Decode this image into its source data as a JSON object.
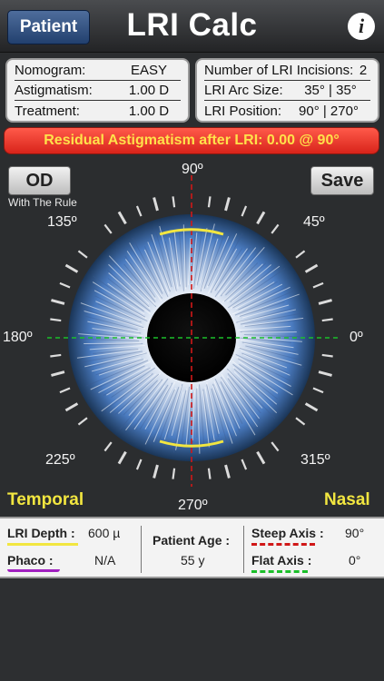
{
  "nav": {
    "back_label": "Patient",
    "title": "LRI Calc",
    "info_icon": "i"
  },
  "summary_left": {
    "nomogram_label": "Nomogram:",
    "nomogram_value": "EASY",
    "astigmatism_label": "Astigmatism:",
    "astigmatism_value": "1.00 D",
    "treatment_label": "Treatment:",
    "treatment_value": "1.00 D"
  },
  "summary_right": {
    "incisions_label": "Number of LRI Incisions:",
    "incisions_value": "2",
    "arc_label": "LRI Arc Size:",
    "arc_value": "35° | 35°",
    "position_label": "LRI Position:",
    "position_value": "90° | 270°"
  },
  "warning": "Residual Astigmatism after LRI: 0.00 @ 90°",
  "eye": {
    "eye_button": "OD",
    "rule_label": "With The Rule",
    "save_button": "Save",
    "deg_90": "90º",
    "deg_45": "45º",
    "deg_135": "135º",
    "deg_180": "180º",
    "deg_0": "0º",
    "deg_225": "225º",
    "deg_315": "315º",
    "deg_270": "270º",
    "temporal": "Temporal",
    "nasal": "Nasal"
  },
  "bottom": {
    "lri_depth_label": "LRI Depth :",
    "lri_depth_value": "600 µ",
    "phaco_label": "Phaco :",
    "phaco_value": "N/A",
    "age_label": "Patient Age :",
    "age_value": "55 y",
    "steep_label": "Steep Axis :",
    "steep_value": "90°",
    "flat_label": "Flat Axis :",
    "flat_value": "0°"
  },
  "colors": {
    "accent_yellow": "#f2e640",
    "warning_red": "#d8231a",
    "steep_axis": "#d01818",
    "flat_axis": "#1bbf2a",
    "phaco": "#a020c0",
    "iris": "#4a7bc0"
  }
}
